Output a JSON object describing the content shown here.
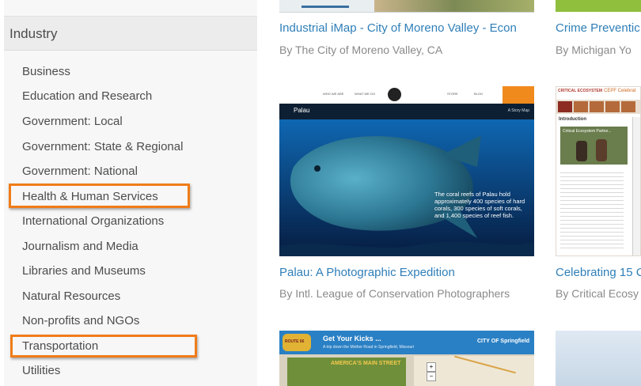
{
  "sidebar": {
    "section_title": "Industry",
    "categories": [
      "Business",
      "Education and Research",
      "Government: Local",
      "Government: State & Regional",
      "Government: National",
      "Health & Human Services",
      "International Organizations",
      "Journalism and Media",
      "Libraries and Museums",
      "Natural Resources",
      "Non-profits and NGOs",
      "Transportation",
      "Utilities"
    ]
  },
  "cards": [
    {
      "title": "Industrial iMap - City of Moreno Valley - Econ",
      "author": "By The City of Moreno Valley, CA"
    },
    {
      "title": "Crime Preventic",
      "author": "By Michigan Yo"
    },
    {
      "title": "Palau: A Photographic Expedition",
      "author": "By Intl. League of Conservation Photographers"
    },
    {
      "title": "Celebrating 15 C",
      "author": "By Critical Ecosy"
    }
  ],
  "palau_thumb": {
    "title": "Palau",
    "badge": "A Story Map",
    "nav": [
      "WHO WE ARE",
      "WHAT WE DO",
      "STORE",
      "BLOG"
    ],
    "caption": "The coral reefs of Palau hold approximately 400 species of hard corals, 300 species of soft corals, and 1,400 species of reef fish."
  },
  "cepf_thumb": {
    "header": "CRITICAL ECOSYSTEM",
    "title": "CEPF Celebrat",
    "section": "Introduction",
    "subtitle": "Critical Ecosystem Partne..."
  },
  "route66_thumb": {
    "title": "Get Your Kicks ...",
    "subtitle": "A trip down the Mother Road in Springfield, Missouri",
    "logo": "CITY OF Springfield",
    "sign": "AMERICA'S MAIN STREET",
    "badge": "ROUTE 66"
  },
  "colors": {
    "highlight": "#f07c19",
    "link": "#2f7fb8",
    "sidebar_bg": "#f7f7f7",
    "header_bg": "#ececec"
  }
}
